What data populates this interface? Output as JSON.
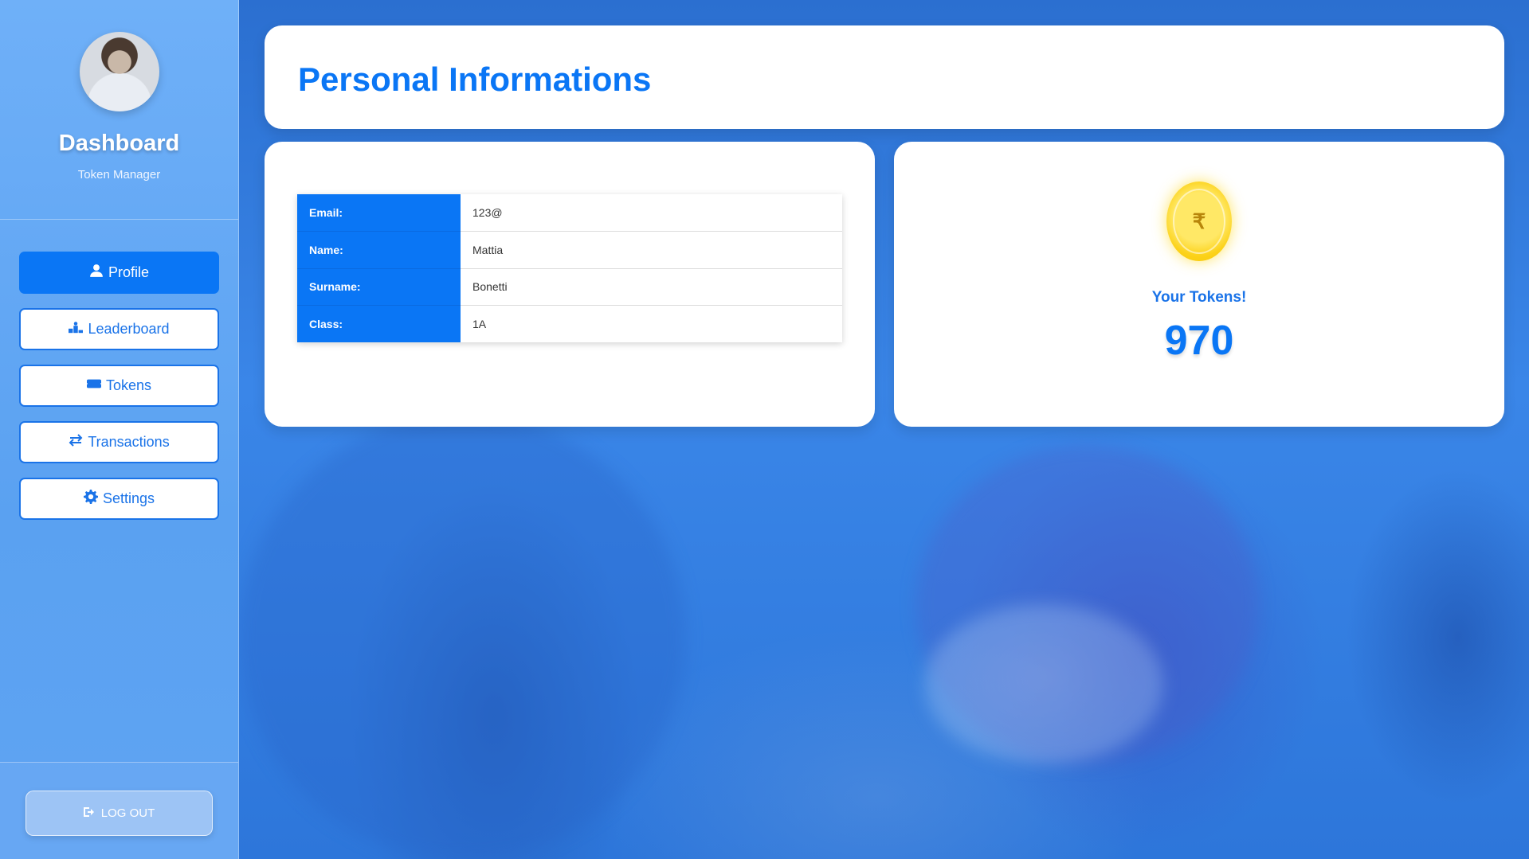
{
  "sidebar": {
    "title": "Dashboard",
    "subtitle": "Token Manager",
    "items": [
      {
        "label": "Profile",
        "icon": "user-icon",
        "active": true
      },
      {
        "label": "Leaderboard",
        "icon": "podium-icon",
        "active": false
      },
      {
        "label": "Tokens",
        "icon": "ticket-icon",
        "active": false
      },
      {
        "label": "Transactions",
        "icon": "arrows-exchange-icon",
        "active": false
      },
      {
        "label": "Settings",
        "icon": "gear-icon",
        "active": false
      }
    ],
    "logout_label": "LOG OUT"
  },
  "header": {
    "title": "Personal Informations"
  },
  "info": {
    "rows": [
      {
        "key": "Email:",
        "value": "123@"
      },
      {
        "key": "Name:",
        "value": "Mattia"
      },
      {
        "key": "Surname:",
        "value": "Bonetti"
      },
      {
        "key": "Class:",
        "value": "1A"
      }
    ]
  },
  "tokens": {
    "label": "Your Tokens!",
    "value": "970",
    "coin_symbol": "₹"
  },
  "colors": {
    "accent": "#0a76f5",
    "sidebar": "#6fb0f8",
    "coin": "#fcd21a"
  }
}
